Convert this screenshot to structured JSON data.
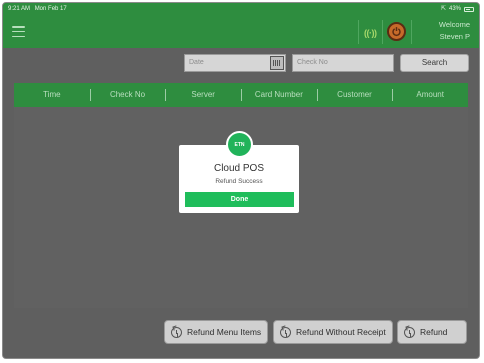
{
  "status_bar": {
    "time": "9:21 AM",
    "date": "Mon Feb 17",
    "battery": "43%"
  },
  "header": {
    "welcome_label": "Welcome",
    "user_name": "Steven P",
    "sync_icon": "wifi-signal-icon",
    "power_icon": "power-icon"
  },
  "search": {
    "date_placeholder": "Date",
    "check_placeholder": "Check No",
    "search_label": "Search"
  },
  "table": {
    "columns": [
      "Time",
      "Check No",
      "Server",
      "Card Number",
      "Customer",
      "Amount"
    ]
  },
  "actions": {
    "refund_menu_items": "Refund Menu Items",
    "refund_without_receipt": "Refund Without Receipt",
    "refund": "Refund"
  },
  "modal": {
    "logo_text": "ETN",
    "title": "Cloud POS",
    "message": "Refund Success",
    "done_label": "Done"
  },
  "colors": {
    "header_green": "#2e8d3f",
    "overlay": "#5f5f5f",
    "done_green": "#1fbd5b"
  }
}
